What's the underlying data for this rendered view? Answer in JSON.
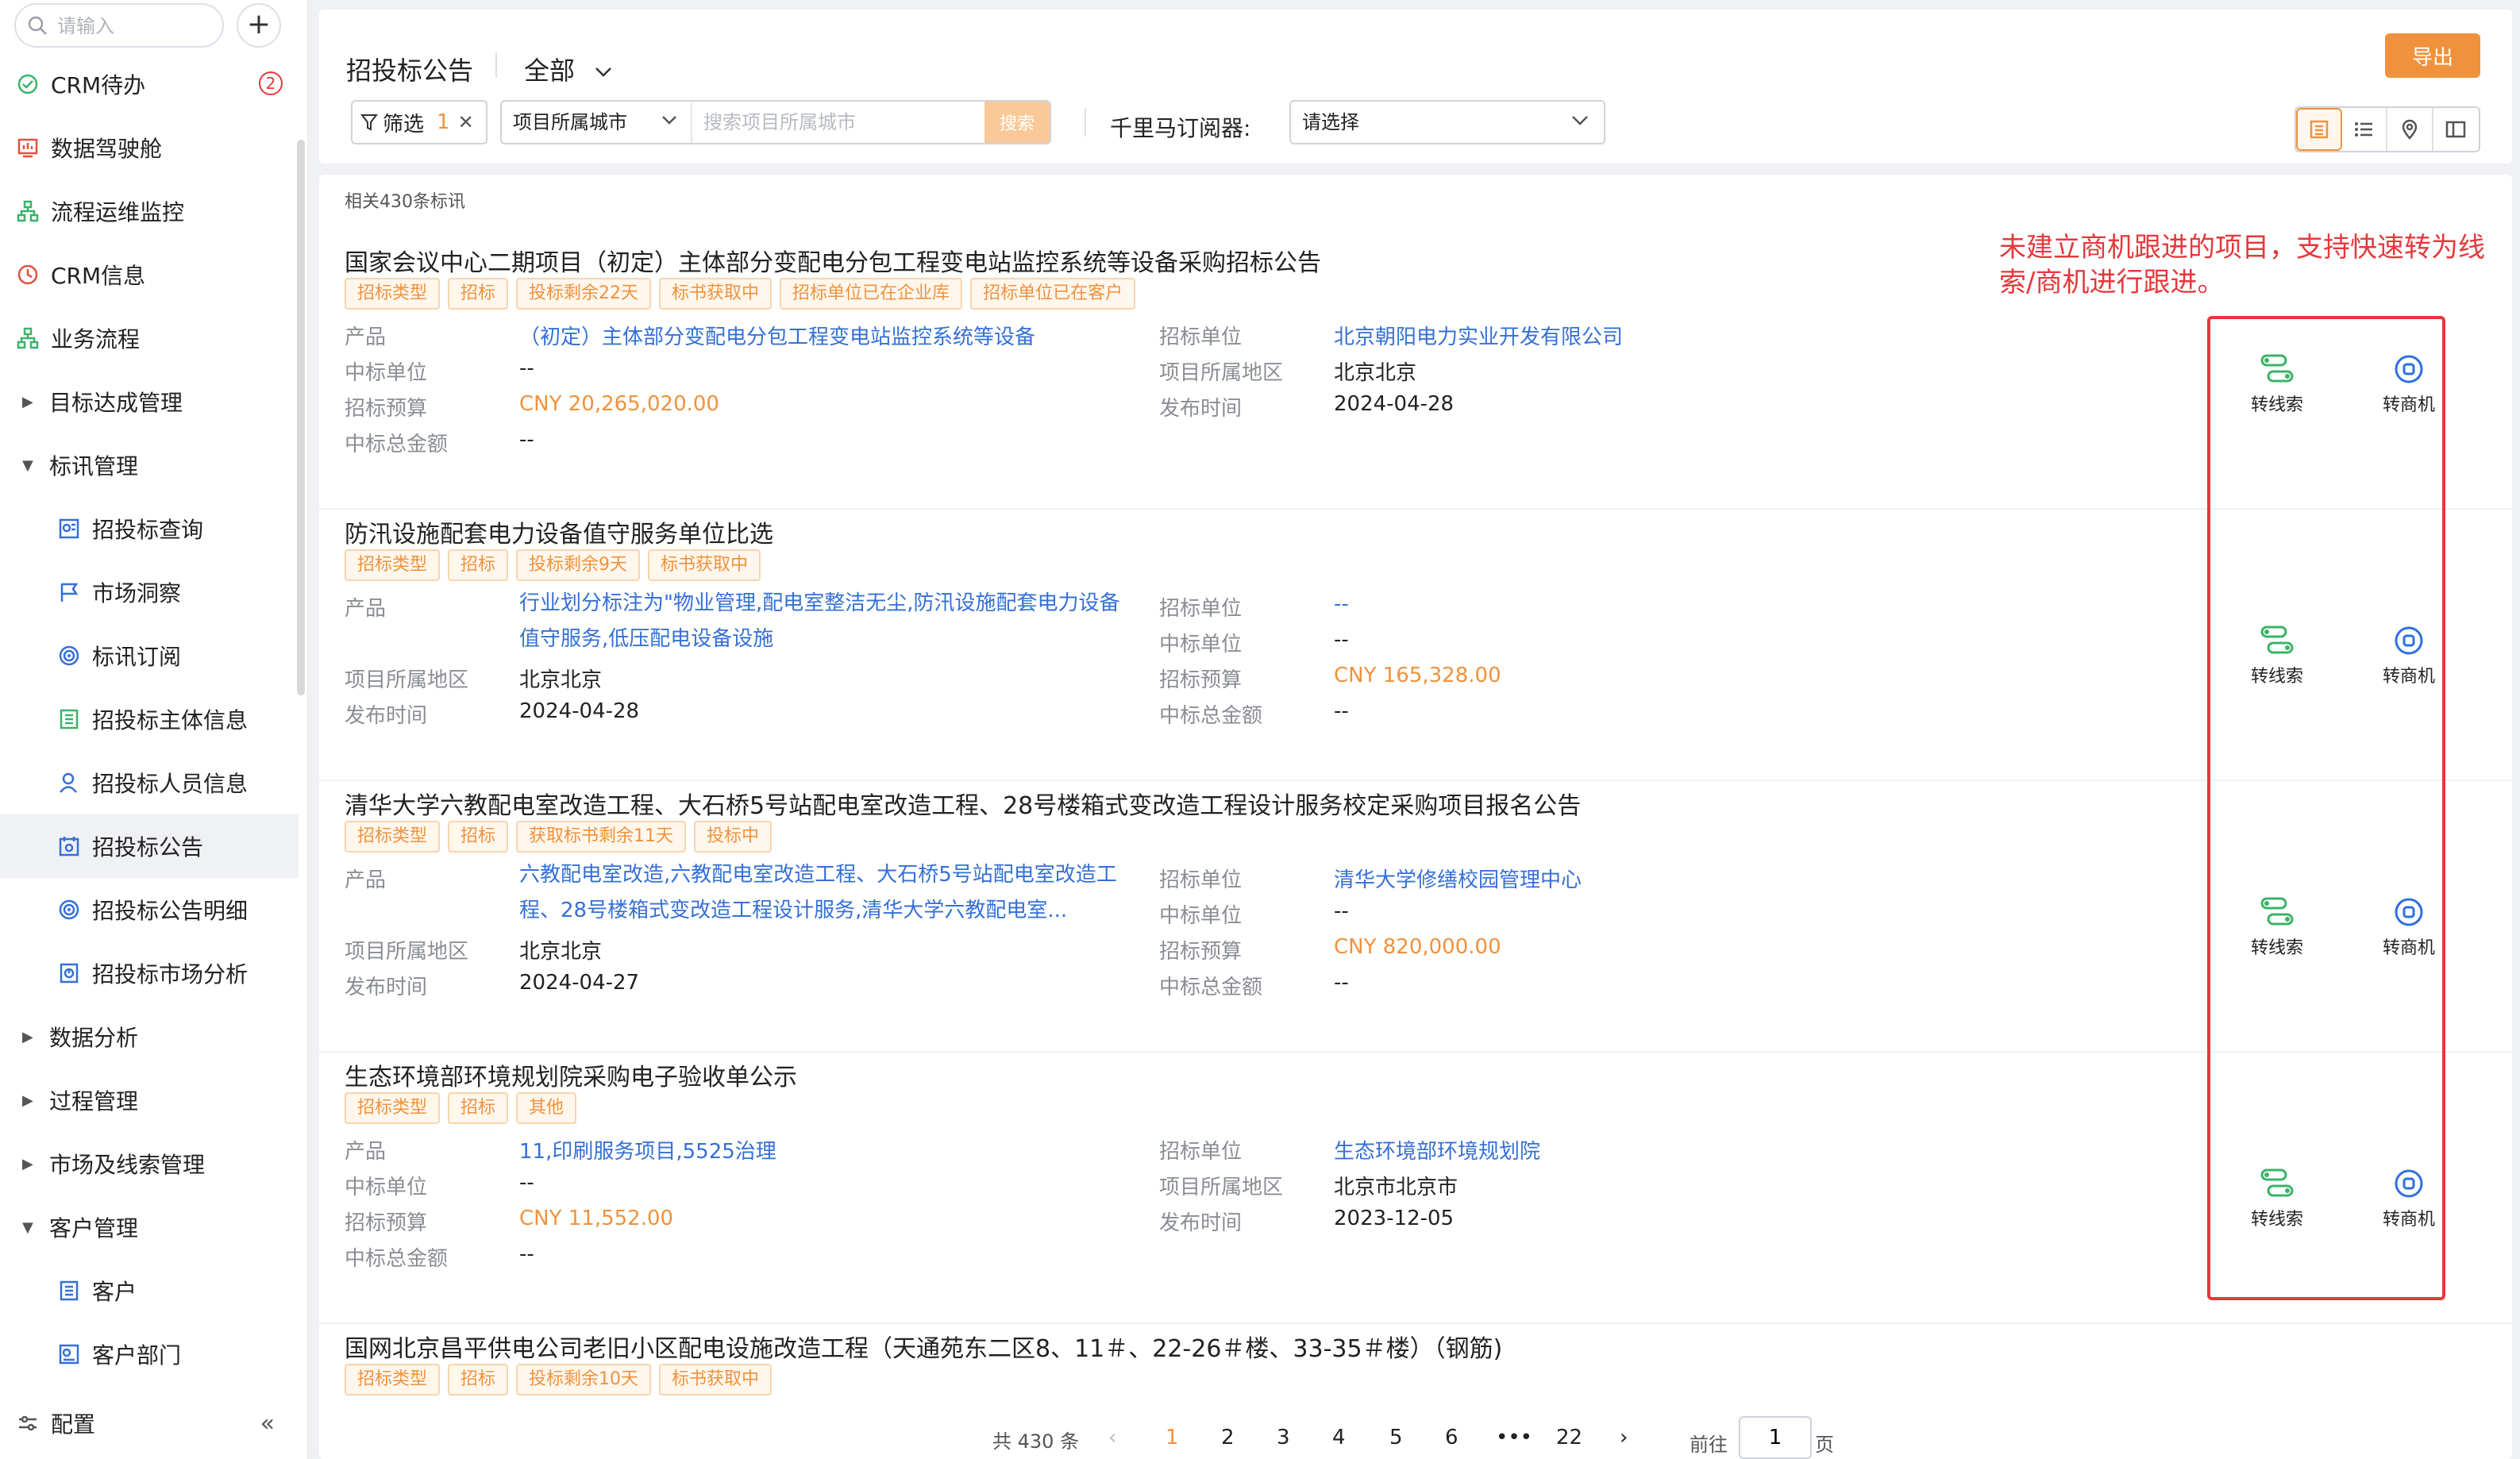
{
  "sidebar": {
    "search_placeholder": "请输入",
    "add_label": "+",
    "items": [
      {
        "label": "CRM待办",
        "badge": "2"
      },
      {
        "label": "数据驾驶舱"
      },
      {
        "label": "流程运维监控"
      },
      {
        "label": "CRM信息"
      },
      {
        "label": "业务流程"
      },
      {
        "label": "目标达成管理"
      },
      {
        "label": "标讯管理"
      },
      {
        "label": "招投标查询"
      },
      {
        "label": "市场洞察"
      },
      {
        "label": "标讯订阅"
      },
      {
        "label": "招投标主体信息"
      },
      {
        "label": "招投标人员信息"
      },
      {
        "label": "招投标公告"
      },
      {
        "label": "招投标公告明细"
      },
      {
        "label": "招投标市场分析"
      },
      {
        "label": "数据分析"
      },
      {
        "label": "过程管理"
      },
      {
        "label": "市场及线索管理"
      },
      {
        "label": "客户管理"
      },
      {
        "label": "客户"
      },
      {
        "label": "客户部门"
      }
    ],
    "footer_label": "配置",
    "collapse_glyph": "«"
  },
  "header": {
    "title": "招投标公告",
    "scope": "全部",
    "export_label": "导出",
    "filter_label": "筛选",
    "filter_count": "1",
    "city_select": "项目所属城市",
    "city_placeholder": "搜索项目所属城市",
    "search_label": "搜索",
    "subscriber_label": "千里马订阅器:",
    "subscriber_value": "请选择"
  },
  "list": {
    "count_text": "相关430条标讯",
    "action_clue": "转线索",
    "action_opportunity": "转商机",
    "items": [
      {
        "title": "国家会议中心二期项目（初定）主体部分变配电分包工程变电站监控系统等设备采购招标公告",
        "tags": [
          "招标类型",
          "招标",
          "投标剩余22天",
          "标书获取中",
          "招标单位已在企业库",
          "招标单位已在客户"
        ],
        "left": [
          {
            "label": "产品",
            "value": "（初定）主体部分变配电分包工程变电站监控系统等设备"
          },
          {
            "label": "中标单位",
            "value": "--"
          },
          {
            "label": "招标预算",
            "value": "CNY 20,265,020.00"
          },
          {
            "label": "中标总金额",
            "value": "--"
          }
        ],
        "right": [
          {
            "label": "招标单位",
            "value": "北京朝阳电力实业开发有限公司"
          },
          {
            "label": "项目所属地区",
            "value": "北京北京"
          },
          {
            "label": "发布时间",
            "value": "2024-04-28"
          }
        ]
      },
      {
        "title": "防汛设施配套电力设备值守服务单位比选",
        "tags": [
          "招标类型",
          "招标",
          "投标剩余9天",
          "标书获取中"
        ],
        "left": [
          {
            "label": "产品",
            "value": "行业划分标注为\"物业管理,配电室整洁无尘,防汛设施配套电力设备值守服务,低压配电设备设施"
          },
          {
            "label": "项目所属地区",
            "value": "北京北京"
          },
          {
            "label": "发布时间",
            "value": "2024-04-28"
          }
        ],
        "right": [
          {
            "label": "招标单位",
            "value": "--"
          },
          {
            "label": "中标单位",
            "value": "--"
          },
          {
            "label": "招标预算",
            "value": "CNY 165,328.00"
          },
          {
            "label": "中标总金额",
            "value": "--"
          }
        ]
      },
      {
        "title": "清华大学六教配电室改造工程、大石桥5号站配电室改造工程、28号楼箱式变改造工程设计服务校定采购项目报名公告",
        "tags": [
          "招标类型",
          "招标",
          "获取标书剩余11天",
          "投标中"
        ],
        "left": [
          {
            "label": "产品",
            "value": "六教配电室改造,六教配电室改造工程、大石桥5号站配电室改造工程、28号楼箱式变改造工程设计服务,清华大学六教配电室..."
          },
          {
            "label": "项目所属地区",
            "value": "北京北京"
          },
          {
            "label": "发布时间",
            "value": "2024-04-27"
          }
        ],
        "right": [
          {
            "label": "招标单位",
            "value": "清华大学修缮校园管理中心"
          },
          {
            "label": "中标单位",
            "value": "--"
          },
          {
            "label": "招标预算",
            "value": "CNY 820,000.00"
          },
          {
            "label": "中标总金额",
            "value": "--"
          }
        ]
      },
      {
        "title": "生态环境部环境规划院采购电子验收单公示",
        "tags": [
          "招标类型",
          "招标",
          "其他"
        ],
        "left": [
          {
            "label": "产品",
            "value": "11,印刷服务项目,5525治理"
          },
          {
            "label": "中标单位",
            "value": "--"
          },
          {
            "label": "招标预算",
            "value": "CNY 11,552.00"
          },
          {
            "label": "中标总金额",
            "value": "--"
          }
        ],
        "right": [
          {
            "label": "招标单位",
            "value": "生态环境部环境规划院"
          },
          {
            "label": "项目所属地区",
            "value": "北京市北京市"
          },
          {
            "label": "发布时间",
            "value": "2023-12-05"
          }
        ]
      },
      {
        "title": "国网北京昌平供电公司老旧小区配电设施改造工程（天通苑东二区8、11＃、22-26＃楼、33-35＃楼）（钢筋)",
        "tags": [
          "招标类型",
          "招标",
          "投标剩余10天",
          "标书获取中"
        ]
      }
    ]
  },
  "annotation": "未建立商机跟进的项目，支持快速转为线索/商机进行跟进。",
  "pagination": {
    "total": "共 430 条",
    "prev": "‹",
    "next": "›",
    "pages": [
      "1",
      "2",
      "3",
      "4",
      "5",
      "6",
      "•••",
      "22"
    ],
    "current": "1",
    "goto_prefix": "前往",
    "goto_value": "1",
    "goto_suffix": "页"
  },
  "colors": {
    "accent": "#f0923c",
    "link": "#3570d6",
    "clue_icon": "#3bb36a",
    "opportunity_icon": "#2f6fe0",
    "annotation": "#e4393c"
  }
}
